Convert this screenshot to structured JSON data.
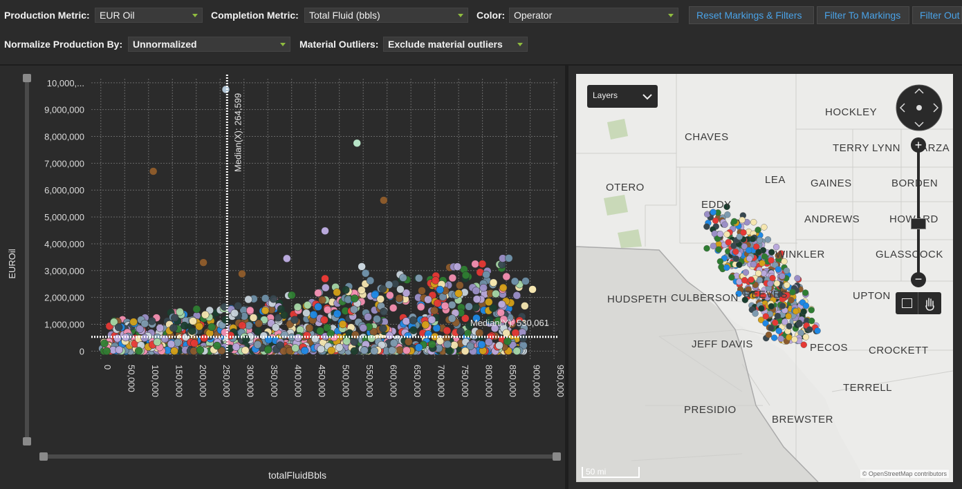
{
  "controls": {
    "production_metric_label": "Production Metric:",
    "production_metric_value": "EUR Oil",
    "completion_metric_label": "Completion Metric:",
    "completion_metric_value": "Total Fluid (bbls)",
    "color_label": "Color:",
    "color_value": "Operator",
    "normalize_label": "Normalize Production By:",
    "normalize_value": "Unnormalized",
    "outliers_label": "Material Outliers:",
    "outliers_value": "Exclude material outliers"
  },
  "buttons": {
    "reset": "Reset Markings & Filters",
    "filter_to": "Filter To Markings",
    "filter_out": "Filter Out"
  },
  "chart_data": {
    "type": "scatter",
    "xlabel": "totalFluidBbls",
    "ylabel": "EUROil",
    "xlim": [
      -20000,
      960000
    ],
    "ylim": [
      -300000,
      10150000
    ],
    "x_ticks": [
      "0",
      "50,000",
      "100,000",
      "150,000",
      "200,000",
      "250,000",
      "300,000",
      "350,000",
      "400,000",
      "450,000",
      "500,000",
      "550,000",
      "600,000",
      "650,000",
      "700,000",
      "750,000",
      "800,000",
      "850,000",
      "900,000",
      "950,000"
    ],
    "y_ticks": [
      "0",
      "1,000,000",
      "2,000,000",
      "3,000,000",
      "4,000,000",
      "5,000,000",
      "6,000,000",
      "7,000,000",
      "8,000,000",
      "9,000,000",
      "10,000,..."
    ],
    "median_x_label": "Median(X): 264,599",
    "median_x": 264599,
    "median_y_label": "Median(Y): 530,061",
    "median_y": 530061,
    "grid": true,
    "outlier_points": [
      {
        "x": 110000,
        "y": 6700000,
        "color": "#8b5a2b"
      },
      {
        "x": 262000,
        "y": 9750000,
        "color": "#b0c4d4"
      },
      {
        "x": 537000,
        "y": 7750000,
        "color": "#b7e4c7"
      },
      {
        "x": 593000,
        "y": 5620000,
        "color": "#8b5a2b"
      },
      {
        "x": 470000,
        "y": 4480000,
        "color": "#b9a9dc"
      },
      {
        "x": 390000,
        "y": 3450000,
        "color": "#b9a9dc"
      },
      {
        "x": 215000,
        "y": 3300000,
        "color": "#8b5a2b"
      },
      {
        "x": 296000,
        "y": 2880000,
        "color": "#8b5a2b"
      },
      {
        "x": 547000,
        "y": 3150000,
        "color": "#c8d4dc"
      },
      {
        "x": 555000,
        "y": 2900000,
        "color": "#6e8fa6"
      },
      {
        "x": 808000,
        "y": 2850000,
        "color": "#6e8fa6"
      },
      {
        "x": 868000,
        "y": 2600000,
        "color": "#6e8fa6"
      },
      {
        "x": 823000,
        "y": 2550000,
        "color": "#f5e6b0"
      },
      {
        "x": 905000,
        "y": 2300000,
        "color": "#f5e6b0"
      },
      {
        "x": 750000,
        "y": 2150000,
        "color": "#d4a017"
      },
      {
        "x": 470000,
        "y": 2700000,
        "color": "#e53935"
      }
    ]
  },
  "map": {
    "layers_label": "Layers",
    "counties": [
      "HOCKLEY",
      "CHAVES",
      "TERRY",
      "LYNN",
      "GARZA",
      "LEA",
      "OTERO",
      "GAINES",
      "BORDEN",
      "EDDY",
      "ANDREWS",
      "HOWARD",
      "WINKLER",
      "GLASSCOCK",
      "HUDSPETH",
      "CULBERSON",
      "REEVES",
      "UPTON",
      "JEFF DAVIS",
      "PECOS",
      "CROCKETT",
      "TERRELL",
      "PRESIDIO",
      "BREWSTER"
    ],
    "scale": "50 mi",
    "attribution": "© OpenStreetMap contributors"
  }
}
